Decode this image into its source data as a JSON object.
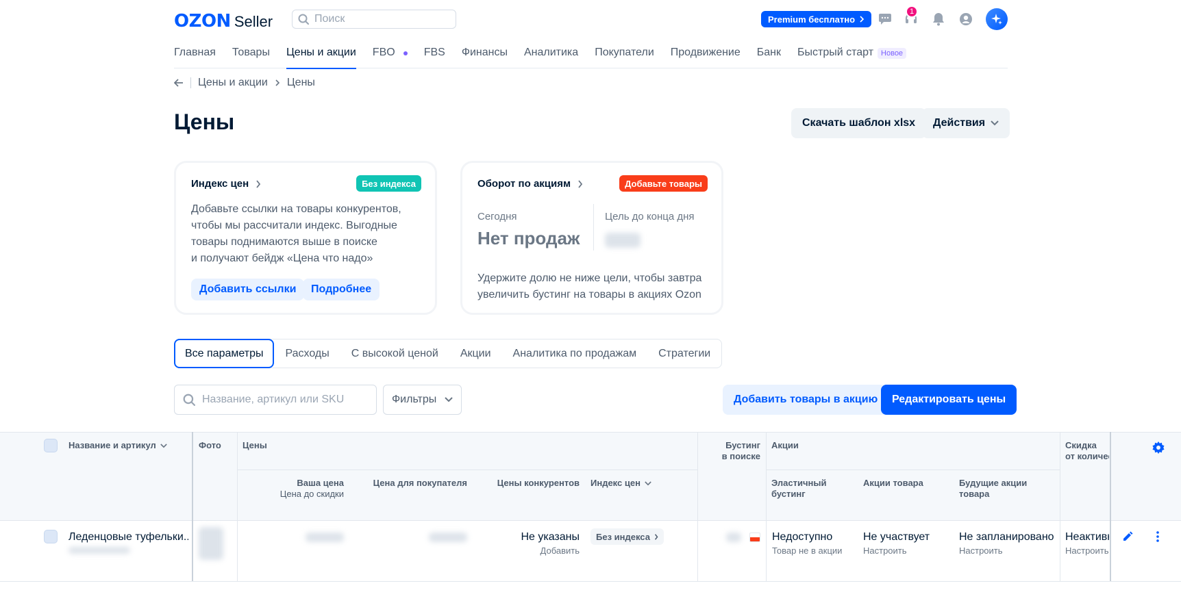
{
  "header": {
    "logo_brand": "OZON",
    "logo_product": "Seller",
    "search_placeholder": "Поиск",
    "premium_label": "Premium бесплатно",
    "support_badge": "1",
    "icons": [
      "chat-icon",
      "headset-icon",
      "bell-icon",
      "user-icon",
      "ai-assistant-icon"
    ]
  },
  "nav": {
    "items": [
      {
        "label": "Главная"
      },
      {
        "label": "Товары"
      },
      {
        "label": "Цены и акции",
        "active": true
      },
      {
        "label": "FBO"
      },
      {
        "label": "FBS"
      },
      {
        "label": "Финансы"
      },
      {
        "label": "Аналитика"
      },
      {
        "label": "Покупатели"
      },
      {
        "label": "Продвижение"
      },
      {
        "label": "Банк"
      },
      {
        "label": "Быстрый старт",
        "tag": "Новое"
      }
    ]
  },
  "breadcrumb": {
    "parent": "Цены и акции",
    "current": "Цены"
  },
  "page": {
    "title": "Цены",
    "download_template": "Скачать шаблон xlsx",
    "actions": "Действия"
  },
  "price_index_card": {
    "title": "Индекс цен",
    "badge": "Без индекса",
    "badge_color": "#10c4b4",
    "text_lines": [
      "Добавьте ссылки на товары конкурентов,",
      "чтобы мы рассчитали индекс. Выгодные",
      "товары поднимаются выше в поиске",
      "и получают бейдж «Цена что надо»"
    ],
    "btn_add_links": "Добавить ссылки",
    "btn_more": "Подробнее"
  },
  "promo_card": {
    "title": "Оборот по акциям",
    "badge": "Добавьте товары",
    "badge_color": "#f93d1a",
    "today_label": "Сегодня",
    "today_value": "Нет продаж",
    "goal_label": "Цель до конца дня",
    "text_lines": [
      "Удержите долю не ниже цели, чтобы завтра",
      "увеличить бустинг на товары в акциях Ozon"
    ]
  },
  "tabs": [
    {
      "label": "Все параметры",
      "active": true
    },
    {
      "label": "Расходы"
    },
    {
      "label": "С высокой ценой"
    },
    {
      "label": "Акции"
    },
    {
      "label": "Аналитика по продажам"
    },
    {
      "label": "Стратегии"
    }
  ],
  "toolbar": {
    "search_placeholder": "Название, артикул или SKU",
    "filters": "Фильтры",
    "add_to_promo": "Добавить товары в акцию",
    "edit_prices": "Редактировать цены"
  },
  "table": {
    "headers": {
      "name": "Название и артикул",
      "photo": "Фото",
      "prices": "Цены",
      "your_price": "Ваша цена",
      "price_before_discount": "Цена до скидки",
      "buyer_price": "Цена для покупателя",
      "competitor_prices": "Цены конкурентов",
      "price_index": "Индекс цен",
      "boost_line1": "Бустинг",
      "boost_line2": "в поиске",
      "promos": "Акции",
      "elastic_line1": "Эластичный",
      "elastic_line2": "бустинг",
      "product_promos": "Акции товара",
      "future_line1": "Будущие акции",
      "future_line2": "товара",
      "qty_line1": "Скидка",
      "qty_line2": "от количес"
    },
    "row": {
      "name": "Леденцовые туфельки...",
      "competitor_price": "Не указаны",
      "competitor_action": "Добавить",
      "index_chip": "Без индекса",
      "elastic": "Недоступно",
      "elastic_sub": "Товар не в акции",
      "promo": "Не участвует",
      "promo_sub": "Настроить",
      "future": "Не запланировано",
      "future_sub": "Настроить",
      "qty": "Неактивн",
      "qty_sub": "Настроить"
    }
  },
  "colors": {
    "accent": "#005bff",
    "text": "#001a34",
    "muted": "#4d5b6c"
  }
}
